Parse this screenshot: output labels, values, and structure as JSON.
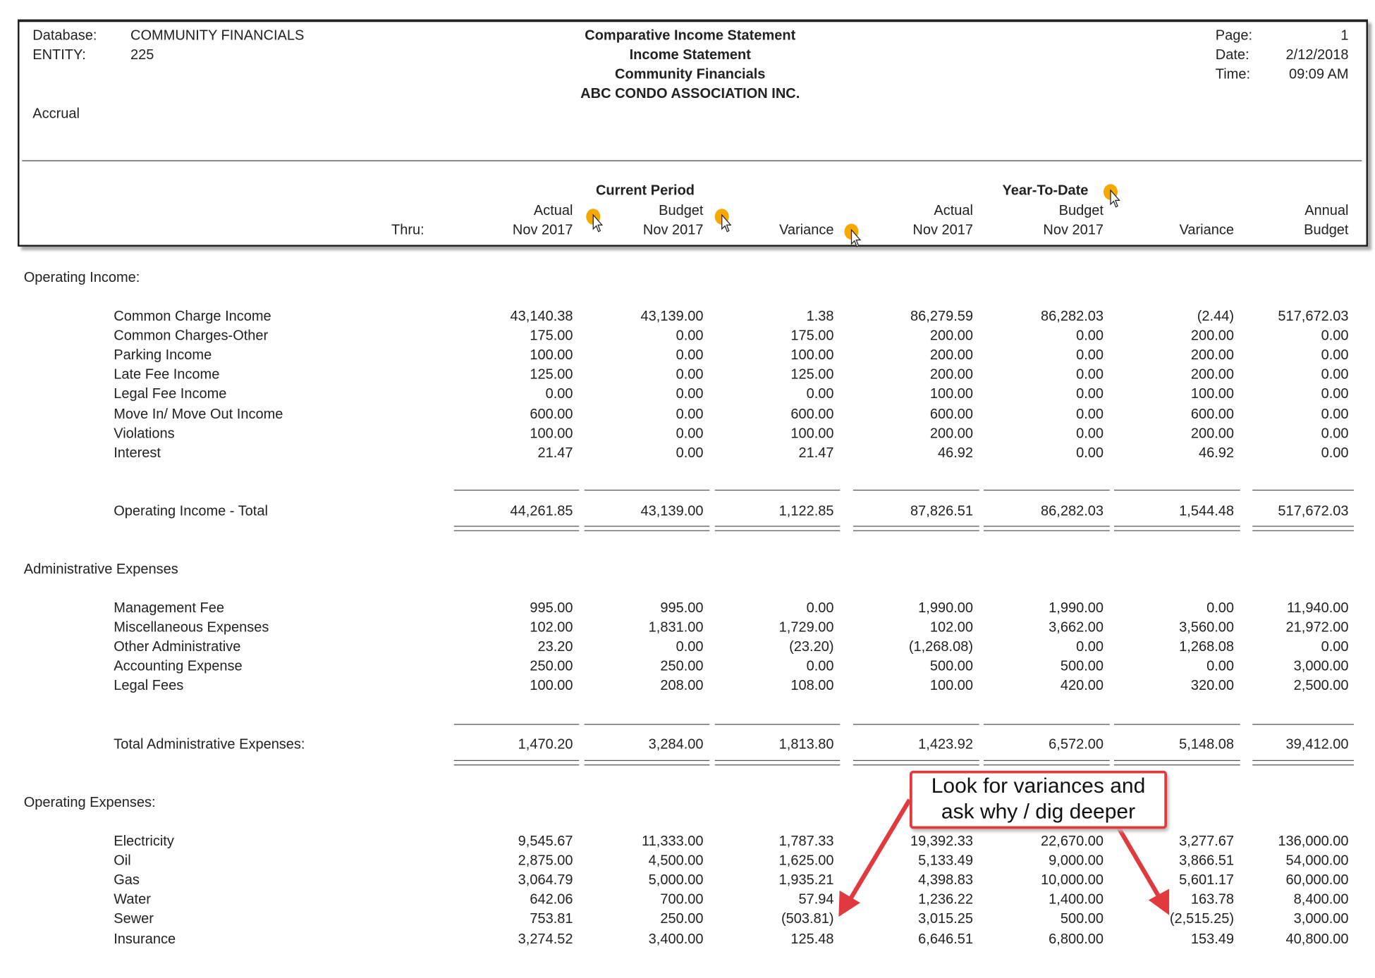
{
  "header": {
    "database_label": "Database:",
    "database_value": "COMMUNITY FINANCIALS",
    "entity_label": "ENTITY:",
    "entity_value": "225",
    "basis": "Accrual",
    "title_lines": [
      "Comparative Income Statement",
      "Income Statement",
      "Community Financials",
      "ABC CONDO ASSOCIATION INC."
    ],
    "page_label": "Page:",
    "page_value": "1",
    "date_label": "Date:",
    "date_value": "2/12/2018",
    "time_label": "Time:",
    "time_value": "09:09 AM"
  },
  "columns": {
    "group_current": "Current Period",
    "group_ytd": "Year-To-Date",
    "thru_label": "Thru:",
    "cols": [
      {
        "top": "Actual",
        "bottom": "Nov 2017"
      },
      {
        "top": "Budget",
        "bottom": "Nov 2017"
      },
      {
        "top": "",
        "bottom": "Variance"
      },
      {
        "top": "Actual",
        "bottom": "Nov 2017"
      },
      {
        "top": "Budget",
        "bottom": "Nov 2017"
      },
      {
        "top": "",
        "bottom": "Variance"
      },
      {
        "top": "Annual",
        "bottom": "Budget"
      }
    ]
  },
  "sections": [
    {
      "title": "Operating Income:",
      "rows": [
        {
          "label": "Common Charge Income",
          "values": [
            "43,140.38",
            "43,139.00",
            "1.38",
            "86,279.59",
            "86,282.03",
            "(2.44)",
            "517,672.03"
          ]
        },
        {
          "label": "Common Charges-Other",
          "values": [
            "175.00",
            "0.00",
            "175.00",
            "200.00",
            "0.00",
            "200.00",
            "0.00"
          ]
        },
        {
          "label": "Parking Income",
          "values": [
            "100.00",
            "0.00",
            "100.00",
            "200.00",
            "0.00",
            "200.00",
            "0.00"
          ]
        },
        {
          "label": "Late Fee Income",
          "values": [
            "125.00",
            "0.00",
            "125.00",
            "200.00",
            "0.00",
            "200.00",
            "0.00"
          ]
        },
        {
          "label": "Legal Fee Income",
          "values": [
            "0.00",
            "0.00",
            "0.00",
            "100.00",
            "0.00",
            "100.00",
            "0.00"
          ]
        },
        {
          "label": "Move In/ Move Out Income",
          "values": [
            "600.00",
            "0.00",
            "600.00",
            "600.00",
            "0.00",
            "600.00",
            "0.00"
          ]
        },
        {
          "label": "Violations",
          "values": [
            "100.00",
            "0.00",
            "100.00",
            "200.00",
            "0.00",
            "200.00",
            "0.00"
          ]
        },
        {
          "label": "Interest",
          "values": [
            "21.47",
            "0.00",
            "21.47",
            "46.92",
            "0.00",
            "46.92",
            "0.00"
          ]
        }
      ],
      "total": {
        "label": "Operating Income - Total",
        "values": [
          "44,261.85",
          "43,139.00",
          "1,122.85",
          "87,826.51",
          "86,282.03",
          "1,544.48",
          "517,672.03"
        ]
      }
    },
    {
      "title": "Administrative Expenses",
      "rows": [
        {
          "label": "Management Fee",
          "values": [
            "995.00",
            "995.00",
            "0.00",
            "1,990.00",
            "1,990.00",
            "0.00",
            "11,940.00"
          ]
        },
        {
          "label": "Miscellaneous Expenses",
          "values": [
            "102.00",
            "1,831.00",
            "1,729.00",
            "102.00",
            "3,662.00",
            "3,560.00",
            "21,972.00"
          ]
        },
        {
          "label": "Other Administrative",
          "values": [
            "23.20",
            "0.00",
            "(23.20)",
            "(1,268.08)",
            "0.00",
            "1,268.08",
            "0.00"
          ]
        },
        {
          "label": "Accounting Expense",
          "values": [
            "250.00",
            "250.00",
            "0.00",
            "500.00",
            "500.00",
            "0.00",
            "3,000.00"
          ]
        },
        {
          "label": "Legal Fees",
          "values": [
            "100.00",
            "208.00",
            "108.00",
            "100.00",
            "420.00",
            "320.00",
            "2,500.00"
          ]
        }
      ],
      "total": {
        "label": "Total Administrative Expenses:",
        "values": [
          "1,470.20",
          "3,284.00",
          "1,813.80",
          "1,423.92",
          "6,572.00",
          "5,148.08",
          "39,412.00"
        ]
      }
    },
    {
      "title": "Operating  Expenses:",
      "rows": [
        {
          "label": "Electricity",
          "values": [
            "9,545.67",
            "11,333.00",
            "1,787.33",
            "19,392.33",
            "22,670.00",
            "3,277.67",
            "136,000.00"
          ]
        },
        {
          "label": "Oil",
          "values": [
            "2,875.00",
            "4,500.00",
            "1,625.00",
            "5,133.49",
            "9,000.00",
            "3,866.51",
            "54,000.00"
          ]
        },
        {
          "label": "Gas",
          "values": [
            "3,064.79",
            "5,000.00",
            "1,935.21",
            "4,398.83",
            "10,000.00",
            "5,601.17",
            "60,000.00"
          ]
        },
        {
          "label": "Water",
          "values": [
            "642.06",
            "700.00",
            "57.94",
            "1,236.22",
            "1,400.00",
            "163.78",
            "8,400.00"
          ]
        },
        {
          "label": "Sewer",
          "values": [
            "753.81",
            "250.00",
            "(503.81)",
            "3,015.25",
            "500.00",
            "(2,515.25)",
            "3,000.00"
          ]
        },
        {
          "label": "Insurance",
          "values": [
            "3,274.52",
            "3,400.00",
            "125.48",
            "6,646.51",
            "6,800.00",
            "153.49",
            "40,800.00"
          ]
        }
      ]
    }
  ],
  "callout": {
    "line1": "Look for variances and",
    "line2": "ask why / dig deeper",
    "color": "#e0393e"
  },
  "cursor_color": "#f5a800"
}
